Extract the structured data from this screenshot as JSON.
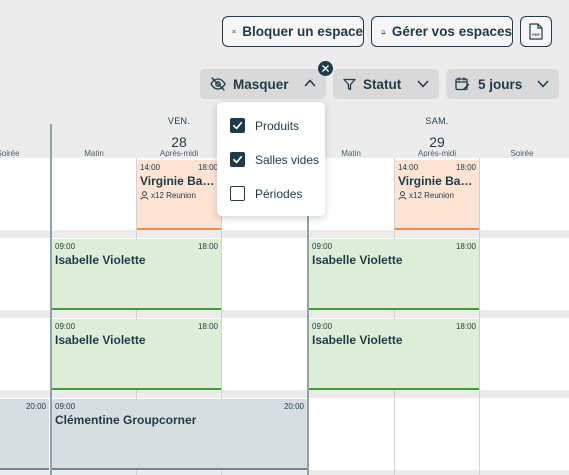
{
  "toolbar": {
    "block_label": "Bloquer un espace",
    "spaces_label": "Gérer vos espaces",
    "pdf_label": "PDF"
  },
  "filters": {
    "masquer_label": "Masquer",
    "statut_label": "Statut",
    "days_label": "5 jours"
  },
  "hide_menu": {
    "options": [
      {
        "label": "Produits",
        "checked": true
      },
      {
        "label": "Salles vides",
        "checked": true
      },
      {
        "label": "Périodes",
        "checked": false
      }
    ]
  },
  "calendar": {
    "days": [
      {
        "name": "VEN.",
        "number": "28"
      },
      {
        "name": "SAM.",
        "number": "29"
      }
    ],
    "periods": {
      "left_soiree": "Soirée",
      "ven_matin": "Matin",
      "ven_apres_midi": "Après-midi",
      "sam_matin": "Matin",
      "sam_apres_midi": "Après-midi",
      "sam_soiree": "Soirée"
    },
    "events": {
      "orange1": {
        "start": "14:00",
        "end": "18:00",
        "name": "Virginie Bac...",
        "meta": "x12 Reunion"
      },
      "orange2": {
        "start": "14:00",
        "end": "18:00",
        "name": "Virginie Bac...",
        "meta": "x12 Reunion"
      },
      "green1": {
        "start": "09:00",
        "end": "18:00",
        "name": "Isabelle Violette"
      },
      "green2": {
        "start": "09:00",
        "end": "18:00",
        "name": "Isabelle Violette"
      },
      "green3": {
        "start": "09:00",
        "end": "18:00",
        "name": "Isabelle Violette"
      },
      "green4": {
        "start": "09:00",
        "end": "18:00",
        "name": "Isabelle Violette"
      },
      "grey_left": {
        "end": "20:00"
      },
      "grey_main": {
        "start": "09:00",
        "end": "20:00",
        "name": "Clémentine Groupcorner"
      }
    }
  },
  "colors": {
    "primary": "#1f3a48",
    "orange_event": "#fde3d3",
    "orange_accent": "#f08a4b",
    "green_event": "#dcefd6",
    "green_accent": "#3f9b35",
    "grey_event": "#d6dee2"
  }
}
